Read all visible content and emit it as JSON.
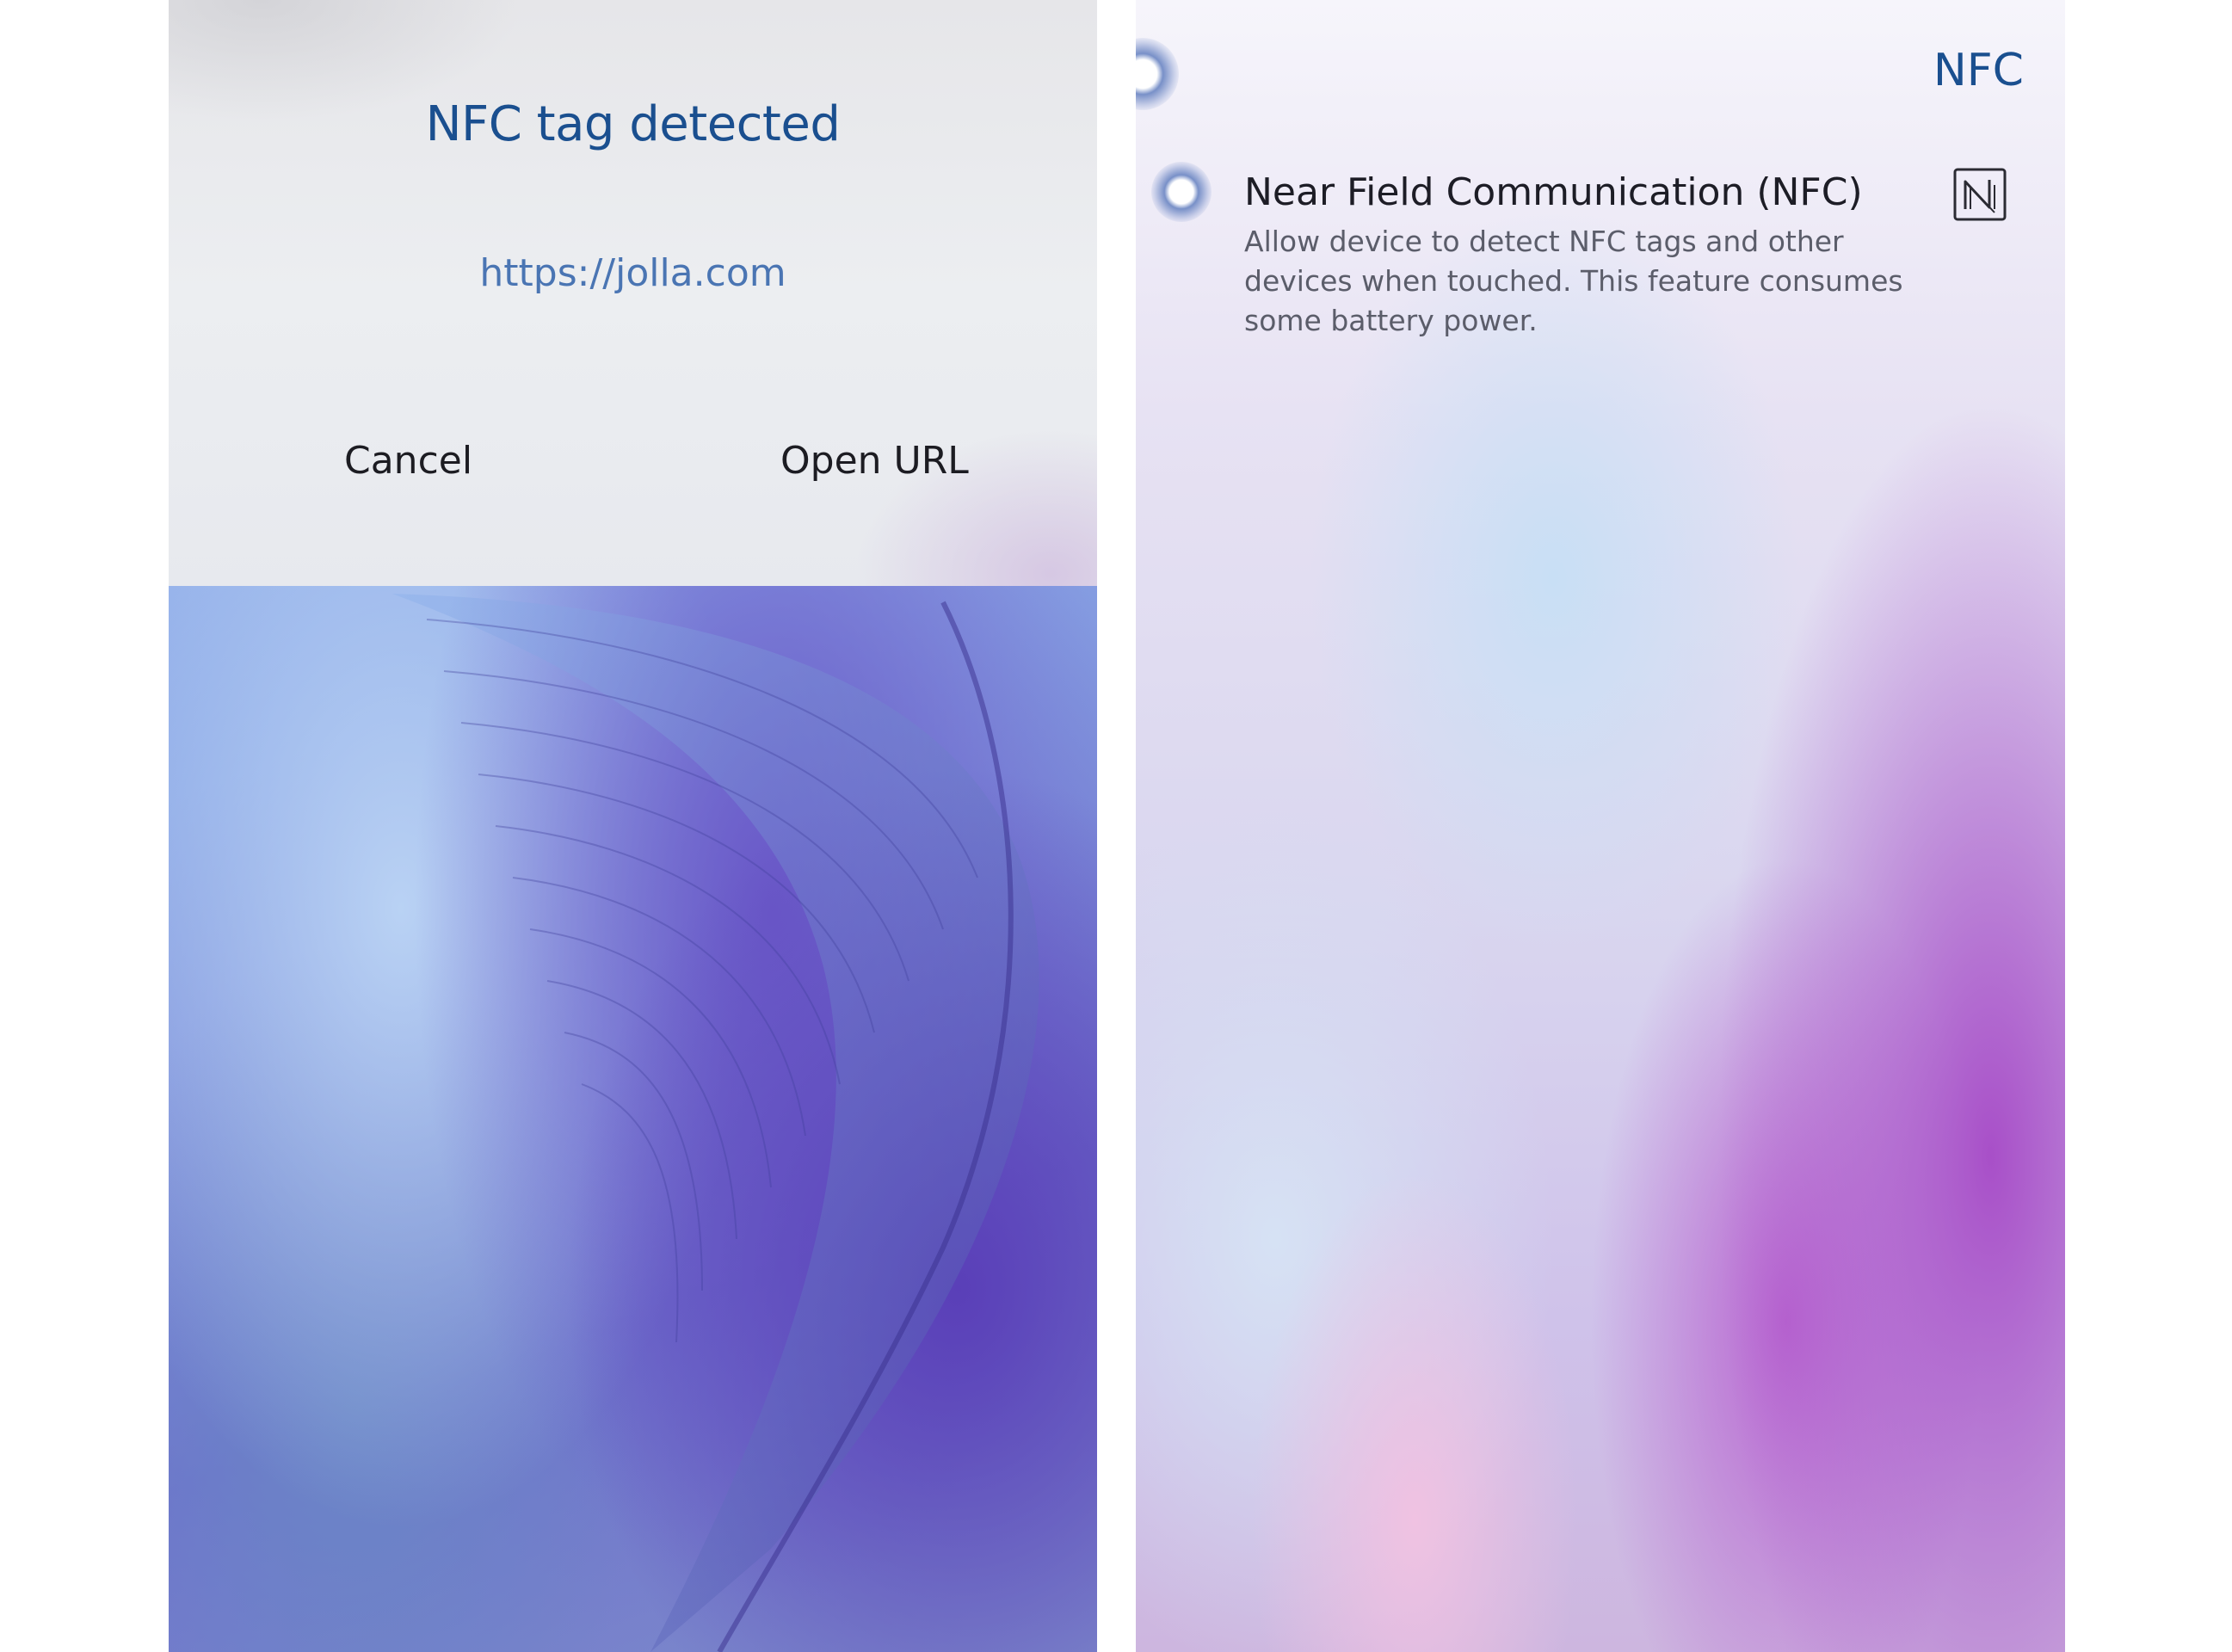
{
  "left_screen": {
    "dialog": {
      "title": "NFC tag detected",
      "url": "https://jolla.com",
      "cancel_label": "Cancel",
      "open_label": "Open URL"
    }
  },
  "right_screen": {
    "header": "NFC",
    "setting": {
      "title": "Near Field Communication (NFC)",
      "description": "Allow device to detect NFC tags and other devices when touched. This feature consumes some battery power.",
      "icon": "nfc-n-icon"
    }
  },
  "colors": {
    "accent_blue": "#1a4f8f",
    "link_blue": "#4a75b3",
    "primary_text": "#1c1c22",
    "secondary_text": "#5b5d6a"
  }
}
